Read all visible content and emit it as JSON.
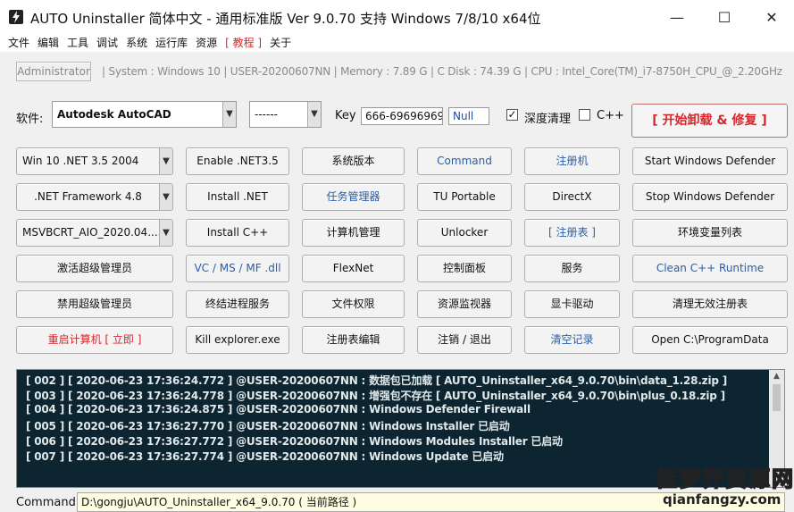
{
  "window": {
    "title": "AUTO Uninstaller 简体中文 - 通用标准版 Ver 9.0.70 支持 Windows 7/8/10 x64位",
    "icon": "lightning-bolt-icon",
    "controls": {
      "minimize": "—",
      "maximize": "☐",
      "close": "✕"
    }
  },
  "menu": [
    "文件",
    "编辑",
    "工具",
    "调试",
    "系统",
    "运行库",
    "资源",
    "[ 教程 ]",
    "关于"
  ],
  "sysbar": {
    "user": "Administrator",
    "info": "| System : Windows 10  |  USER-20200607NN  |  Memory : 7.89 G  |  C Disk : 74.39 G  |  CPU : Intel_Core(TM)_i7-8750H_CPU_@_2.20GHz"
  },
  "software": {
    "label": "软件:",
    "selected": "Autodesk AutoCAD",
    "version": "------",
    "key_label": "Key",
    "key_value": "666-69696969",
    "key_extra": "Null",
    "deep_clean_label": "深度清理",
    "deep_clean_checked": true,
    "cpp_label": "C++",
    "cpp_checked": false,
    "start_button": "[  开始卸载 & 修复  ]"
  },
  "grid": [
    [
      "Win 10 .NET 3.5 2004",
      "Enable .NET3.5",
      "系统版本",
      "Command",
      "注册机",
      "Start  Windows Defender"
    ],
    [
      ".NET Framework 4.8",
      "Install .NET",
      "任务管理器",
      "TU Portable",
      "DirectX",
      "Stop  Windows Defender"
    ],
    [
      "MSVBCRT_AIO_2020.04....",
      "Install C++",
      "计算机管理",
      "Unlocker",
      "[  注册表  ]",
      "环境变量列表"
    ],
    [
      "激活超级管理员",
      "VC / MS / MF .dll",
      "FlexNet",
      "控制面板",
      "服务",
      "Clean C++ Runtime"
    ],
    [
      "禁用超级管理员",
      "终结进程服务",
      "文件权限",
      "资源监视器",
      "显卡驱动",
      "清理无效注册表"
    ],
    [
      "重启计算机 [ 立即 ]",
      "Kill explorer.exe",
      "注册表编辑",
      "注销 / 退出",
      "清空记录",
      "Open C:\\ProgramData"
    ]
  ],
  "log": [
    "[ 002 ] [ 2020-06-23 17:36:24.772 ] @USER-20200607NN : 数据包已加载 [ AUTO_Uninstaller_x64_9.0.70\\bin\\data_1.28.zip ]",
    "[ 003 ] [ 2020-06-23 17:36:24.778 ] @USER-20200607NN : 增强包不存在 [ AUTO_Uninstaller_x64_9.0.70\\bin\\plus_0.18.zip ]",
    "[ 004 ] [ 2020-06-23 17:36:24.875 ] @USER-20200607NN : Windows Defender Firewall",
    "[ 005 ] [ 2020-06-23 17:36:27.770 ] @USER-20200607NN : Windows Installer 已启动",
    "[ 006 ] [ 2020-06-23 17:36:27.772 ] @USER-20200607NN : Windows Modules Installer 已启动",
    "[ 007 ] [ 2020-06-23 17:36:27.774 ] @USER-20200607NN : Windows Update 已启动"
  ],
  "command": {
    "label": "Command",
    "value": "D:\\gongju\\AUTO_Uninstaller_x64_9.0.70 ( 当前路径 )"
  },
  "watermark": {
    "cn": "佳梦乔资源网",
    "en": "qianfangzy.com"
  },
  "colors": {
    "red_text": "#d8252b",
    "blue_text": "#2b5ea7",
    "log_bg": "#0c2530",
    "cmd_bg": "#fffde1"
  }
}
